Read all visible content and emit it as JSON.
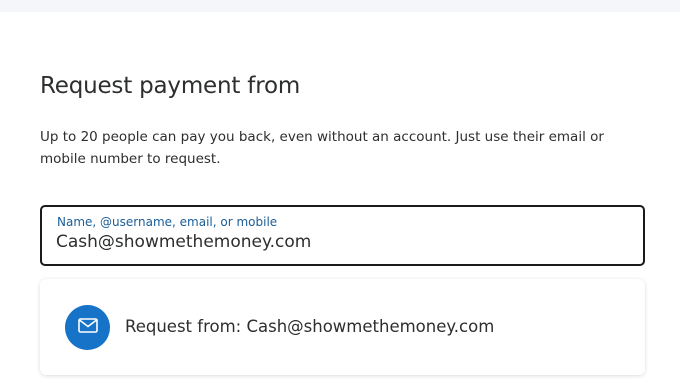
{
  "page": {
    "title": "Request payment from",
    "description": "Up to 20 people can pay you back, even without an account. Just use their email or mobile number to request."
  },
  "recipient_field": {
    "label": "Name, @username, email, or mobile",
    "value": "Cash@showmethemoney.com"
  },
  "suggestion": {
    "icon": "mail-icon",
    "label": "Request from: Cash@showmethemoney.com"
  },
  "colors": {
    "accent": "#1773c7",
    "label_blue": "#1a5d98",
    "text": "#2c2e2f",
    "field_border": "#1a1a1a"
  }
}
